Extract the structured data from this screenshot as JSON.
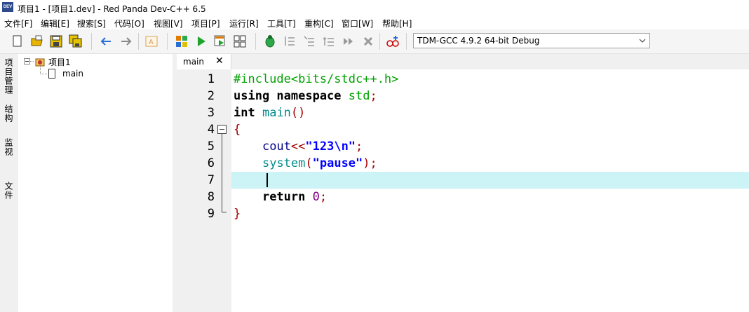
{
  "window": {
    "title": "项目1 - [项目1.dev] - Red Panda Dev-C++ 6.5",
    "icon_text": "DEV"
  },
  "menu": [
    "文件[F]",
    "编辑[E]",
    "搜索[S]",
    "代码[O]",
    "视图[V]",
    "项目[P]",
    "运行[R]",
    "工具[T]",
    "重构[C]",
    "窗口[W]",
    "帮助[H]"
  ],
  "toolbar": {
    "buttons": [
      "new-file-icon",
      "open-folder-icon",
      "save-icon",
      "save-all-icon",
      "back-arrow-icon",
      "forward-arrow-icon",
      "format-icon",
      "compile-icon",
      "run-icon",
      "compile-run-icon",
      "rebuild-icon",
      "debug-icon",
      "step-over-icon",
      "step-into-icon",
      "step-out-icon",
      "continue-icon",
      "stop-icon",
      "add-watch-icon"
    ],
    "compiler": "TDM-GCC 4.9.2 64-bit Debug"
  },
  "left_tabs": [
    "项目管理",
    "结构",
    "监视",
    "文件"
  ],
  "tree": {
    "root": "项目1",
    "child": "main"
  },
  "editor": {
    "tab": "main",
    "close": "✕",
    "line_numbers": [
      "1",
      "2",
      "3",
      "4",
      "5",
      "6",
      "7",
      "8",
      "9"
    ],
    "current_line": 7
  },
  "colors": {
    "accent_line": "#ccf4f7",
    "keyword": "#000000",
    "include": "#00a000",
    "type": "#00008b",
    "string": "#0000ff",
    "brace": "#a50000",
    "number": "#800080"
  }
}
